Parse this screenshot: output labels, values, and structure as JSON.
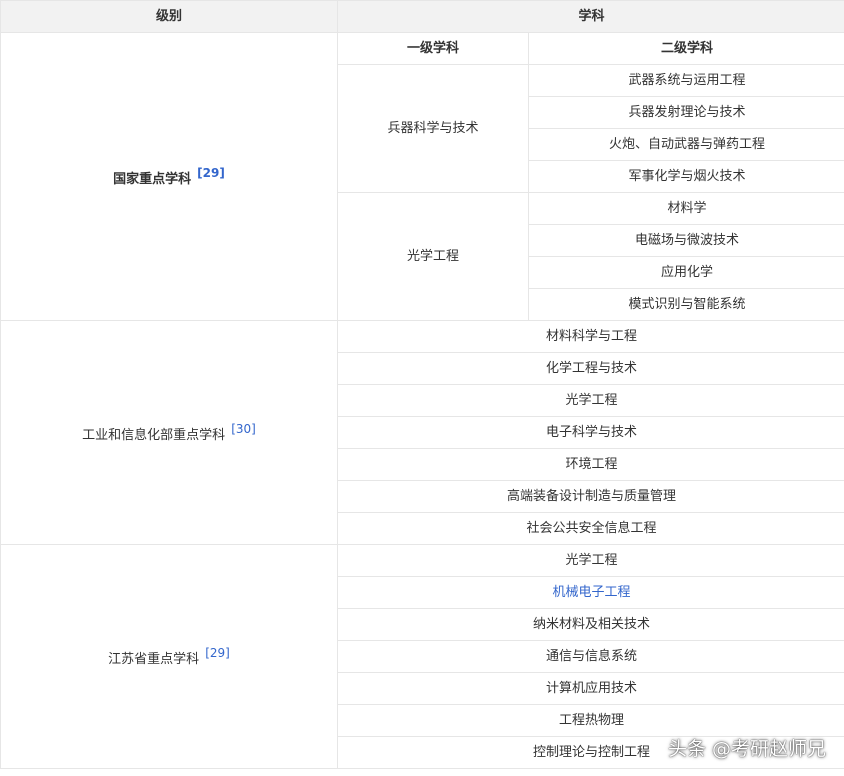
{
  "header": {
    "level": "级别",
    "discipline": "学科"
  },
  "subheader": {
    "first": "一级学科",
    "second": "二级学科"
  },
  "national": {
    "label": "国家重点学科",
    "ref": "[29]",
    "groups": [
      {
        "first": "兵器科学与技术",
        "seconds": [
          "武器系统与运用工程",
          "兵器发射理论与技术",
          "火炮、自动武器与弹药工程",
          "军事化学与烟火技术"
        ]
      },
      {
        "first": "光学工程",
        "seconds": [
          "材料学",
          "电磁场与微波技术",
          "应用化学",
          "模式识别与智能系统"
        ]
      }
    ]
  },
  "miit": {
    "label": "工业和信息化部重点学科",
    "ref": "[30]",
    "items": [
      "材料科学与工程",
      "化学工程与技术",
      "光学工程",
      "电子科学与技术",
      "环境工程",
      "高端装备设计制造与质量管理",
      "社会公共安全信息工程"
    ]
  },
  "jiangsu": {
    "label": "江苏省重点学科",
    "ref": "[29]",
    "items": [
      "光学工程",
      "机械电子工程",
      "纳米材料及相关技术",
      "通信与信息系统",
      "计算机应用技术",
      "工程热物理",
      "控制理论与控制工程"
    ]
  },
  "colors": {
    "header_bg": "#f2f2f2",
    "border": "#e6e6e6",
    "link": "#3366cc"
  },
  "watermark": "头条 @考研赵师兄"
}
